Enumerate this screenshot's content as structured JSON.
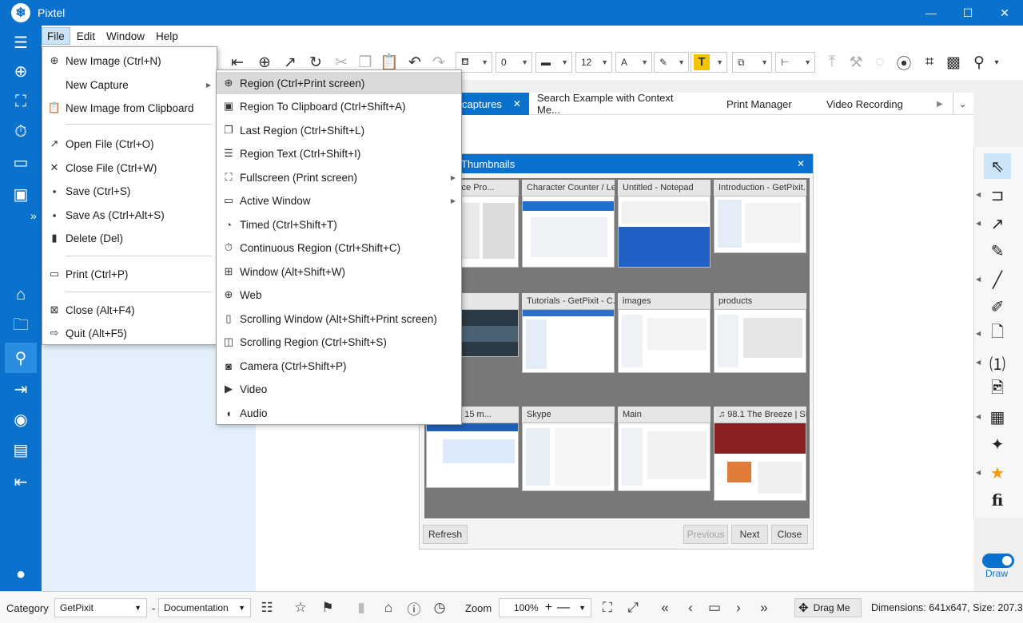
{
  "window": {
    "title": "Pixtel",
    "minimize": "—",
    "maximize": "☐",
    "close": "✕"
  },
  "menubar": [
    "File",
    "Edit",
    "Window",
    "Help"
  ],
  "toolbar": {
    "line_width": "0",
    "font_size": "12",
    "font_color_letter": "A",
    "text_letter": "T",
    "accent_yellow": "#f5c400"
  },
  "tabs": [
    {
      "label": "captures",
      "active": true,
      "close": "✕"
    },
    {
      "label": "Search Example with Context Me..."
    },
    {
      "label": "Print Manager"
    },
    {
      "label": "Video Recording"
    }
  ],
  "file_menu": [
    {
      "label": "New Image (Ctrl+N)",
      "icon": "plus-circle-icon"
    },
    {
      "label": "New Capture",
      "icon": "",
      "submenu": true,
      "open": true
    },
    {
      "label": "New Image from Clipboard",
      "icon": "clipboard-icon"
    },
    {
      "label": "Open File (Ctrl+O)",
      "icon": "open-file-icon"
    },
    {
      "label": "Close File (Ctrl+W)",
      "icon": "close-x-icon"
    },
    {
      "label": "Save (Ctrl+S)",
      "icon": "save-icon"
    },
    {
      "label": "Save As (Ctrl+Alt+S)",
      "icon": "save-as-icon"
    },
    {
      "label": "Delete (Del)",
      "icon": "trash-icon"
    },
    {
      "label": "Print (Ctrl+P)",
      "icon": "printer-icon"
    },
    {
      "label": "Close (Alt+F4)",
      "icon": "close-box-icon"
    },
    {
      "label": "Quit (Alt+F5)",
      "icon": "exit-icon"
    }
  ],
  "capture_menu": [
    {
      "label": "Region (Ctrl+Print screen)",
      "icon": "crosshair-icon",
      "highlight": true
    },
    {
      "label": "Region To Clipboard (Ctrl+Shift+A)",
      "icon": "clipboard-region-icon"
    },
    {
      "label": "Last Region (Ctrl+Shift+L)",
      "icon": "last-region-icon"
    },
    {
      "label": "Region Text (Ctrl+Shift+I)",
      "icon": "text-doc-icon"
    },
    {
      "label": "Fullscreen (Print screen)",
      "icon": "fullscreen-icon",
      "submenu": true
    },
    {
      "label": "Active Window",
      "icon": "window-icon",
      "submenu": true
    },
    {
      "label": "Timed (Ctrl+Shift+T)",
      "icon": "timer-icon"
    },
    {
      "label": "Continuous Region (Ctrl+Shift+C)",
      "icon": "stopwatch-icon"
    },
    {
      "label": "Window (Alt+Shift+W)",
      "icon": "windows-logo-icon"
    },
    {
      "label": "Web",
      "icon": "globe-icon"
    },
    {
      "label": "Scrolling Window (Alt+Shift+Print screen)",
      "icon": "scroll-window-icon"
    },
    {
      "label": "Scrolling Region (Ctrl+Shift+S)",
      "icon": "scroll-region-icon"
    },
    {
      "label": "Camera (Ctrl+Shift+P)",
      "icon": "camera-icon"
    },
    {
      "label": "Video",
      "icon": "video-icon"
    },
    {
      "label": "Audio",
      "icon": "audio-icon"
    }
  ],
  "thumbnails": {
    "title": "Thumbnails",
    "close": "✕",
    "items": [
      "entSource Pro...",
      "Character Counter / Le...",
      "Untitled - Notepad",
      "Introduction - GetPixit...",
      "",
      "Tutorials - GetPixit - C...",
      "images",
      "products",
      "nce and 15 m...",
      "Skype",
      "Main",
      "♫ 98.1 The Breeze | SF..."
    ],
    "buttons": {
      "refresh": "Refresh",
      "previous": "Previous",
      "next": "Next",
      "close": "Close"
    }
  },
  "right_tools": [
    "cursor-icon",
    "text-box-icon",
    "arrow-icon",
    "pen-icon",
    "line-icon",
    "marker-icon",
    "page-icon",
    "number-badge-icon",
    "image-file-icon",
    "calendar-clock-icon",
    "sparkle-icon",
    "star-icon",
    "ligature-fi-icon"
  ],
  "draw": {
    "label": "Draw",
    "on": true
  },
  "status": {
    "category_label": "Category",
    "category_value": "GetPixit",
    "dash": "-",
    "subcategory_value": "Documentation",
    "zoom_label": "Zoom",
    "zoom_value": "100%",
    "drag_label": "Drag Me",
    "dimensions": "Dimensions: 641x647, Size: 207.3"
  }
}
